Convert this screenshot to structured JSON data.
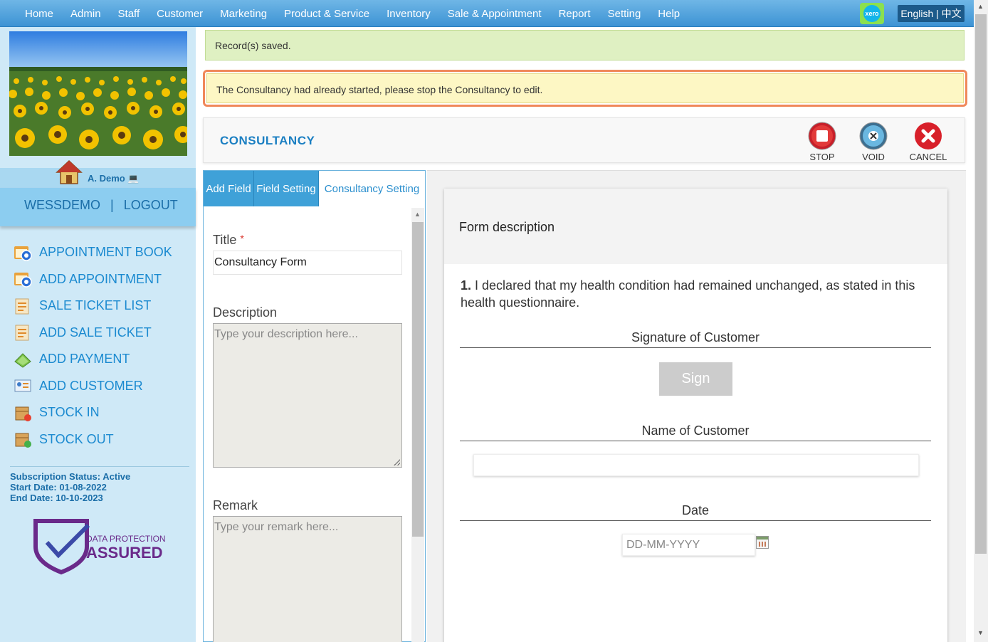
{
  "topnav": {
    "items": [
      "Home",
      "Admin",
      "Staff",
      "Customer",
      "Marketing",
      "Product & Service",
      "Inventory",
      "Sale & Appointment",
      "Report",
      "Setting",
      "Help"
    ],
    "xero_label": "xero",
    "language": "English | 中文"
  },
  "sidebar": {
    "user_name": "A. Demo",
    "user_icon": "laptop-icon",
    "account": "WESSDEMO",
    "separator": "|",
    "logout": "LOGOUT",
    "items": [
      {
        "label": "APPOINTMENT BOOK",
        "icon": "appointment-book-icon"
      },
      {
        "label": "ADD APPOINTMENT",
        "icon": "add-appointment-icon"
      },
      {
        "label": "SALE TICKET LIST",
        "icon": "ticket-list-icon"
      },
      {
        "label": "ADD SALE TICKET",
        "icon": "add-ticket-icon"
      },
      {
        "label": "ADD PAYMENT",
        "icon": "payment-icon"
      },
      {
        "label": "ADD CUSTOMER",
        "icon": "add-customer-icon"
      },
      {
        "label": "STOCK IN",
        "icon": "stock-in-icon"
      },
      {
        "label": "STOCK OUT",
        "icon": "stock-out-icon"
      }
    ],
    "subscription": {
      "status": "Subscription Status: Active",
      "start": "Start Date: 01-08-2022",
      "end": "End Date: 10-10-2023"
    },
    "badge": {
      "line1": "DATA PROTECTION",
      "line2": "ASSURED"
    }
  },
  "alerts": {
    "success": "Record(s) saved.",
    "warning": "The Consultancy had already started, please stop the Consultancy to edit."
  },
  "header": {
    "title": "CONSULTANCY",
    "buttons": {
      "stop": "STOP",
      "void": "VOID",
      "cancel": "CANCEL"
    }
  },
  "left_panel": {
    "tabs": [
      "Add Field",
      "Field Setting",
      "Consultancy Setting"
    ],
    "title_label": "Title",
    "required_mark": "*",
    "title_value": "Consultancy Form",
    "description_label": "Description",
    "description_placeholder": "Type your description here...",
    "remark_label": "Remark",
    "remark_placeholder": "Type your remark here..."
  },
  "form_preview": {
    "description": "Form description",
    "q_number": "1.",
    "q_text": "I declared that my health condition had remained unchanged, as stated in this health questionnaire.",
    "signature_label": "Signature of Customer",
    "sign_button": "Sign",
    "name_label": "Name of Customer",
    "date_label": "Date",
    "date_placeholder": "DD-MM-YYYY"
  },
  "colors": {
    "nav_blue": "#3d93d4",
    "link_blue": "#1b8ad0",
    "success_bg": "#dff0c2",
    "warning_bg": "#fdf7c4",
    "warning_border": "#f0885a"
  }
}
